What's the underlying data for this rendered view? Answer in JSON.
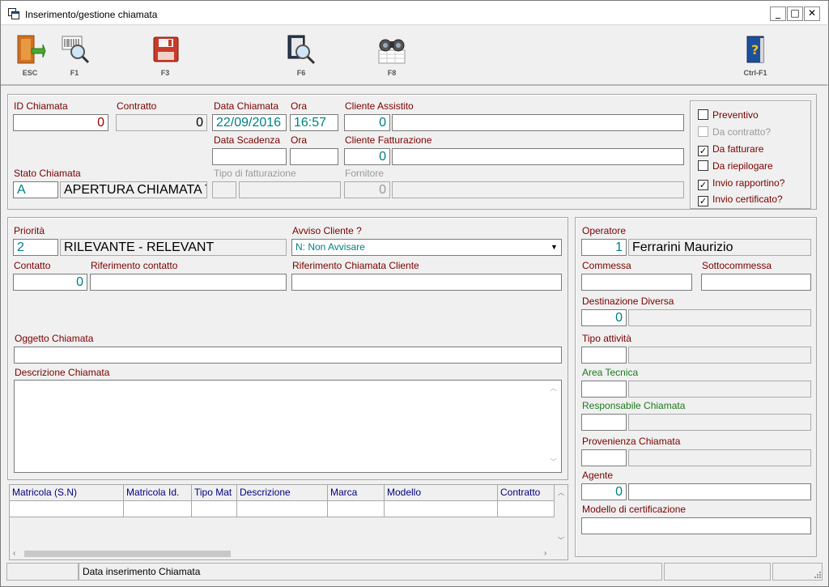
{
  "window": {
    "title": "Inserimento/gestione chiamata",
    "minimize": "_",
    "maximize": "□",
    "close": "✕"
  },
  "toolbar": {
    "esc": "ESC",
    "f1": "F1",
    "f3": "F3",
    "f6": "F6",
    "f8": "F8",
    "ctrlf1": "Ctrl-F1"
  },
  "header": {
    "id_label": "ID Chiamata",
    "id_value": "0",
    "contratto_label": "Contratto",
    "contratto_value": "0",
    "data_label": "Data Chiamata",
    "data_value": "22/09/2016",
    "ora_label": "Ora",
    "ora_value": "16:57",
    "cliente_assistito_label": "Cliente Assistito",
    "cliente_assistito_value": "0",
    "cliente_assistito_name": "",
    "data_scadenza_label": "Data Scadenza",
    "data_scadenza_value": "",
    "ora2_label": "Ora",
    "ora2_value": "",
    "cliente_fatt_label": "Cliente Fatturazione",
    "cliente_fatt_value": "0",
    "cliente_fatt_name": "",
    "stato_label": "Stato Chiamata",
    "stato_code": "A",
    "stato_desc": "APERTURA CHIAMATA T",
    "tipo_fatt_label": "Tipo di fatturazione",
    "fornitore_label": "Fornitore",
    "fornitore_value": "0"
  },
  "options": [
    {
      "label": "Preventivo",
      "checked": false,
      "disabled": false
    },
    {
      "label": "Da contratto?",
      "checked": false,
      "disabled": true
    },
    {
      "label": "Da fatturare",
      "checked": true,
      "disabled": false
    },
    {
      "label": "Da riepilogare",
      "checked": false,
      "disabled": false
    },
    {
      "label": "Invio rapportino?",
      "checked": true,
      "disabled": false
    },
    {
      "label": "Invio certificato?",
      "checked": true,
      "disabled": false
    }
  ],
  "main": {
    "priorita_label": "Priorità",
    "priorita_code": "2",
    "priorita_desc": "RILEVANTE - RELEVANT",
    "avviso_label": "Avviso Cliente ?",
    "avviso_value": "N: Non Avvisare",
    "contatto_label": "Contatto",
    "contatto_value": "0",
    "rif_contatto_label": "Riferimento contatto",
    "rif_cliente_label": "Riferimento Chiamata Cliente",
    "oggetto_label": "Oggetto Chiamata",
    "descrizione_label": "Descrizione Chiamata"
  },
  "grid": {
    "columns": [
      "Matricola (S.N)",
      "Matricola Id.",
      "Tipo Mat",
      "Descrizione",
      "Marca",
      "Modello",
      "Contratto"
    ]
  },
  "right": {
    "operatore_label": "Operatore",
    "operatore_code": "1",
    "operatore_name": "Ferrarini Maurizio",
    "commessa_label": "Commessa",
    "sottocommessa_label": "Sottocommessa",
    "destinazione_label": "Destinazione Diversa",
    "destinazione_value": "0",
    "tipo_attivita_label": "Tipo attività",
    "area_tecnica_label": "Area Tecnica",
    "responsabile_label": "Responsabile Chiamata",
    "provenienza_label": "Provenienza Chiamata",
    "agente_label": "Agente",
    "agente_value": "0",
    "modello_cert_label": "Modello di certificazione"
  },
  "status": {
    "message": "Data inserimento Chiamata"
  }
}
